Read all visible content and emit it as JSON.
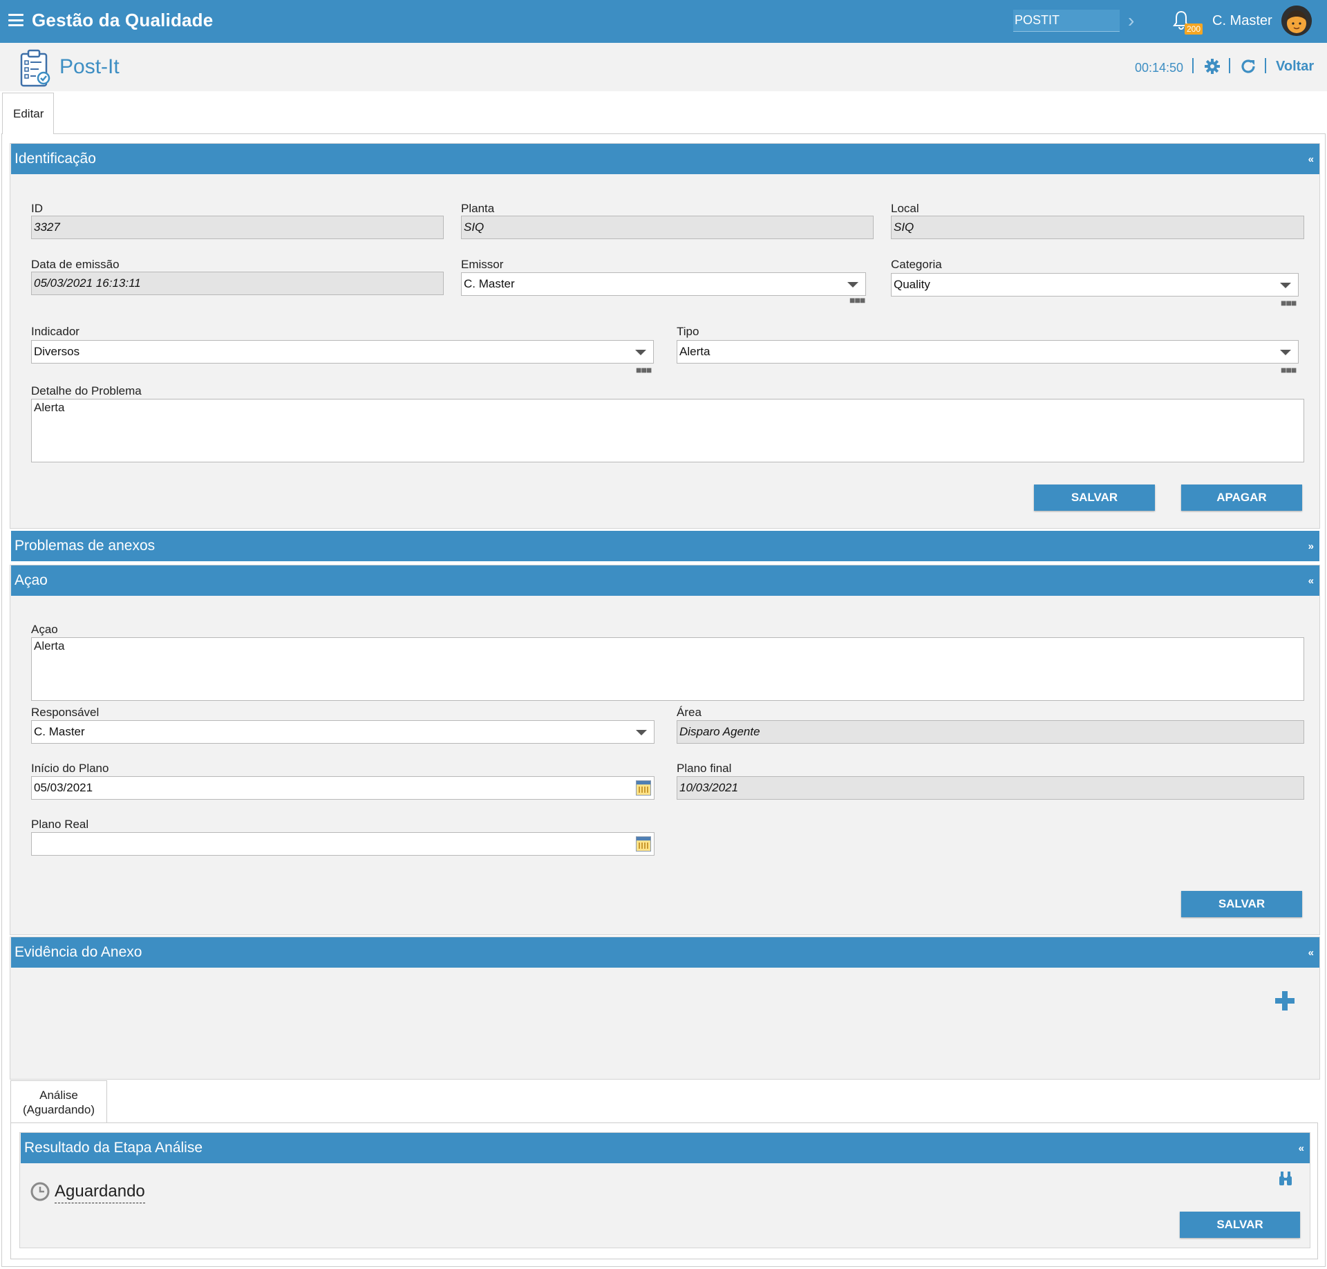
{
  "app": {
    "title": "Gestão da Qualidade",
    "module_input": "POSTIT",
    "notif_count": "200",
    "user": "C. Master"
  },
  "page": {
    "title": "Post-It",
    "timer": "00:14:50",
    "back_label": "Voltar"
  },
  "tabs": {
    "main": "Editar",
    "analysis_line1": "Análise",
    "analysis_line2": "(Aguardando)"
  },
  "identificacao": {
    "title": "Identificação",
    "id_label": "ID",
    "id_value": "3327",
    "planta_label": "Planta",
    "planta_value": "SIQ",
    "local_label": "Local",
    "local_value": "SIQ",
    "data_label": "Data de emissão",
    "data_value": "05/03/2021 16:13:11",
    "emissor_label": "Emissor",
    "emissor_value": "C. Master",
    "categoria_label": "Categoria",
    "categoria_value": "Quality",
    "indicador_label": "Indicador",
    "indicador_value": "Diversos",
    "tipo_label": "Tipo",
    "tipo_value": "Alerta",
    "detalhe_label": "Detalhe do Problema",
    "detalhe_value": "Alerta",
    "save": "SALVAR",
    "delete": "APAGAR"
  },
  "anexos": {
    "title": "Problemas de anexos"
  },
  "acao": {
    "title": "Açao",
    "acao_label": "Açao",
    "acao_value": "Alerta",
    "resp_label": "Responsável",
    "resp_value": "C. Master",
    "area_label": "Área",
    "area_value": "Disparo Agente",
    "inicio_label": "Início do Plano",
    "inicio_value": "05/03/2021",
    "final_label": "Plano final",
    "final_value": "10/03/2021",
    "real_label": "Plano Real",
    "real_value": "",
    "save": "SALVAR"
  },
  "evidencia": {
    "title": "Evidência do Anexo"
  },
  "resultado": {
    "title": "Resultado da Etapa Análise",
    "status": "Aguardando",
    "save": "SALVAR"
  },
  "icons": {
    "menu": "hamburger-icon",
    "bell": "bell-icon",
    "gear": "gear-icon",
    "refresh": "refresh-icon",
    "add": "plus-icon",
    "search": "binoculars-icon",
    "clock": "clock-icon",
    "calendar": "calendar-icon"
  },
  "colors": {
    "primary": "#3d8ec3",
    "badge": "#f5a623",
    "panel": "#f2f2f2",
    "readonly": "#e4e4e4"
  }
}
